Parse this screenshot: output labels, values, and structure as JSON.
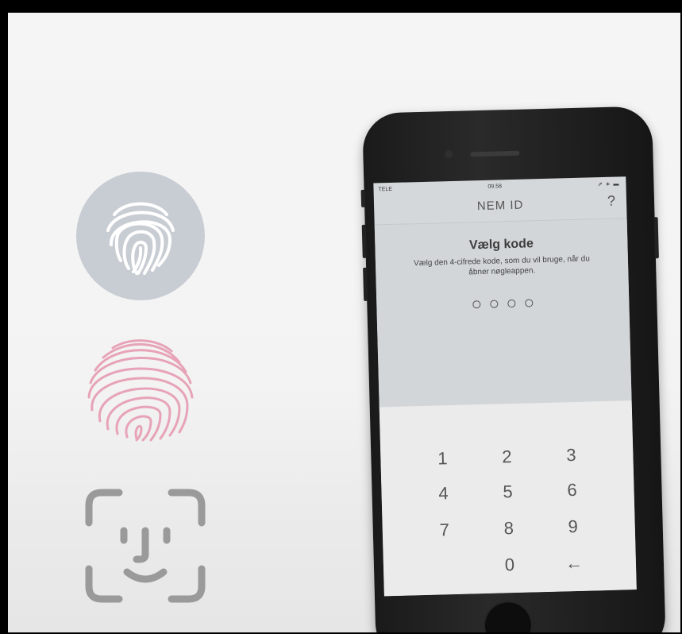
{
  "phone": {
    "status": {
      "carrier": "TELE",
      "time": "09.58",
      "icons": "⇗ ∗ ▬"
    },
    "nav": {
      "title": "NEM ID",
      "help": "?"
    },
    "code": {
      "title": "Vælg kode",
      "description": "Vælg den 4-cifrede kode, som du vil bruge, når du åbner nøgleappen."
    },
    "keypad": {
      "k1": "1",
      "k2": "2",
      "k3": "3",
      "k4": "4",
      "k5": "5",
      "k6": "6",
      "k7": "7",
      "k8": "8",
      "k9": "9",
      "k0": "0",
      "back": "←"
    }
  },
  "icons": {
    "touch_id": "fingerprint-icon",
    "fingerprint": "fingerprint-icon",
    "face_id": "face-id-icon"
  },
  "colors": {
    "touch_circle": "#c8cdd3",
    "fingerprint_pink": "#e7a3b7",
    "face_id_gray": "#9a9a9a",
    "keypad_bg": "#ebebeb"
  }
}
